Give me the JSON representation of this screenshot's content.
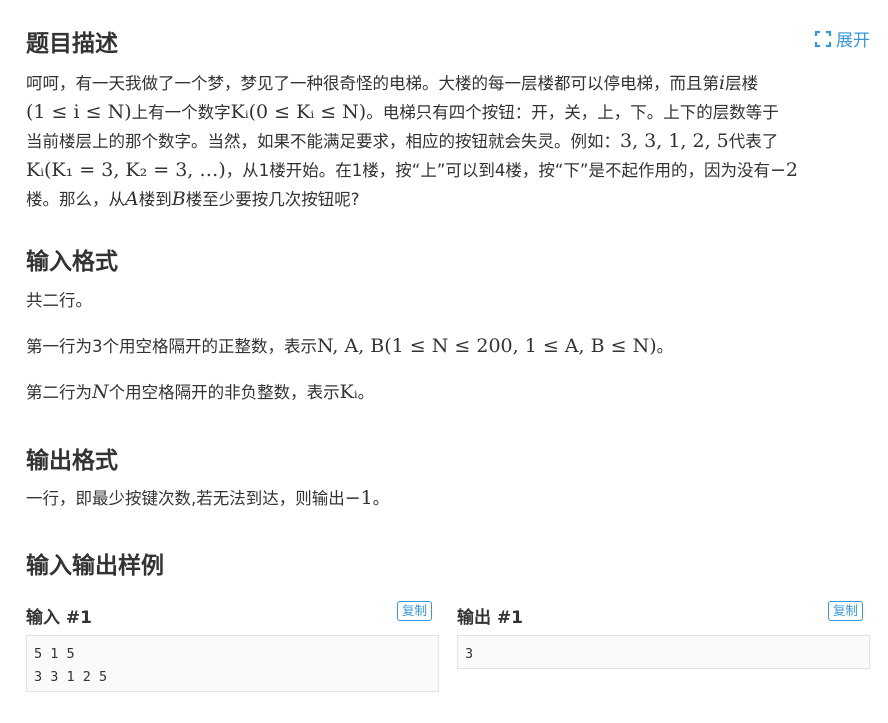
{
  "header": {
    "title": "题目描述",
    "expand_label": "展开"
  },
  "description": {
    "line1_a": "呵呵，有一天我做了一个梦，梦见了一种很奇怪的电梯。大楼的每一层楼都可以停电梯，而且第",
    "line1_var": "i",
    "line1_b": "层楼",
    "line2_math1": "(1 ≤ i ≤ N)",
    "line2_a": "上有一个数字",
    "line2_math2": "Kᵢ(0 ≤ Kᵢ ≤ N)",
    "line2_b": "。电梯只有四个按钮：开，关，上，下。上下的层数等于",
    "line3_a": "当前楼层上的那个数字。当然，如果不能满足要求，相应的按钮就会失灵。例如：",
    "line3_math": "3, 3, 1, 2, 5",
    "line3_b": "代表了",
    "line4_math": "Kᵢ(K₁ = 3, K₂ = 3, …)",
    "line4_a": "，从1楼开始。在1楼，按“上”可以到4楼，按“下”是不起作用的，因为没有",
    "line4_math2": "−2",
    "line5_a": "楼。那么，从",
    "line5_var_a": "A",
    "line5_b": "楼到",
    "line5_var_b": "B",
    "line5_c": "楼至少要按几次按钮呢?"
  },
  "input_format": {
    "title": "输入格式",
    "p1": "共二行。",
    "p2_a": "第一行为3个用空格隔开的正整数，表示",
    "p2_math": "N, A, B(1 ≤ N ≤ 200, 1 ≤ A, B ≤ N)",
    "p2_b": "。",
    "p3_a": "第二行为",
    "p3_var": "N",
    "p3_b": "个用空格隔开的非负整数，表示",
    "p3_math": "Kᵢ",
    "p3_c": "。"
  },
  "output_format": {
    "title": "输出格式",
    "p1_a": "一行，即最少按键次数,若无法到达，则输出",
    "p1_math": "−1",
    "p1_b": "。"
  },
  "samples": {
    "title": "输入输出样例",
    "input_label": "输入 #1",
    "output_label": "输出 #1",
    "copy_label": "复制",
    "input_text": "5 1 5\n3 3 1 2 5",
    "output_text": "3"
  },
  "colors": {
    "accent": "#3498db",
    "text": "#333333",
    "code_bg": "#fafafa",
    "code_border": "#e1e1e1"
  }
}
